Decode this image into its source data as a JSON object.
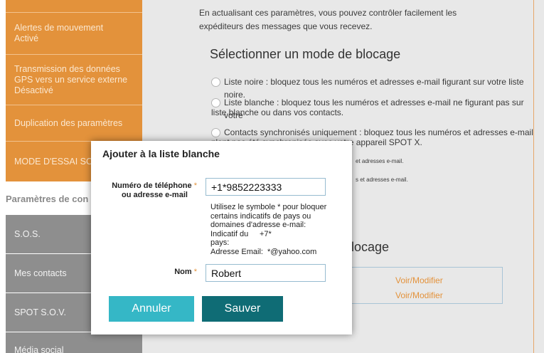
{
  "sidebar": {
    "items": [
      {
        "line1": "Alertes de mouvement",
        "line2": "Activé"
      },
      {
        "line1": "Transmission des données",
        "line2": "GPS vers un service externe",
        "line3": "Désactivé"
      },
      {
        "line1": "Duplication des paramètres"
      },
      {
        "line1": "MODE D'ESSAI SO"
      }
    ],
    "section_title": "Paramètres de con",
    "gray_items": [
      "S.O.S.",
      "Mes contacts",
      "SPOT S.O.V.",
      "Média social"
    ]
  },
  "main": {
    "intro_line1": "En actualisant ces paramètres, vous pouvez contrôler facilement les",
    "intro_line2": "expéditeurs des messages que vous recevez.",
    "heading": "Sélectionner un mode de blocage",
    "options": [
      {
        "line1": "Liste noire : bloquez tous les numéros et adresses e-mail figurant sur votre liste noire."
      },
      {
        "line1": "Liste blanche : bloquez tous les numéros et adresses e-mail ne figurant pas sur votre",
        "line2": "liste blanche ou dans vos contacts."
      },
      {
        "line1": "Contacts synchronisés uniquement : bloquez tous les numéros et adresses e-mail qui",
        "line2": "n'ont pas été synchronisés avec votre appareil SPOT X."
      }
    ],
    "partial_small_1": "et adresses e-mail.",
    "partial_small_2": "s et adresses e-mail.",
    "partial_heading": "locage",
    "links": [
      "Voir/Modifier",
      "Voir/Modifier"
    ]
  },
  "modal": {
    "title": "Ajouter à la liste blanche",
    "phone_label_line1": "Numéro de téléphone",
    "phone_label_line2": "ou adresse e-mail",
    "required_mark": "*",
    "phone_value": "+1*9852223333",
    "help_lines": [
      "Utilisez le symbole * pour bloquer",
      "certains indicatifs de pays ou",
      "domaines d'adresse e-mail:"
    ],
    "help_country_label_1": "Indicatif du",
    "help_country_label_2": "pays:",
    "help_country_value": "+7*",
    "help_email_label": "Adresse Email:",
    "help_email_value": "*@yahoo.com",
    "name_label": "Nom",
    "name_value": "Robert",
    "cancel_label": "Annuler",
    "save_label": "Sauver"
  },
  "colors": {
    "sidebar_orange": "#e3923b",
    "sidebar_gray": "#8e8e8e",
    "cancel_button": "#35b7c6",
    "save_button": "#0f6c75",
    "link": "#e3923b"
  }
}
